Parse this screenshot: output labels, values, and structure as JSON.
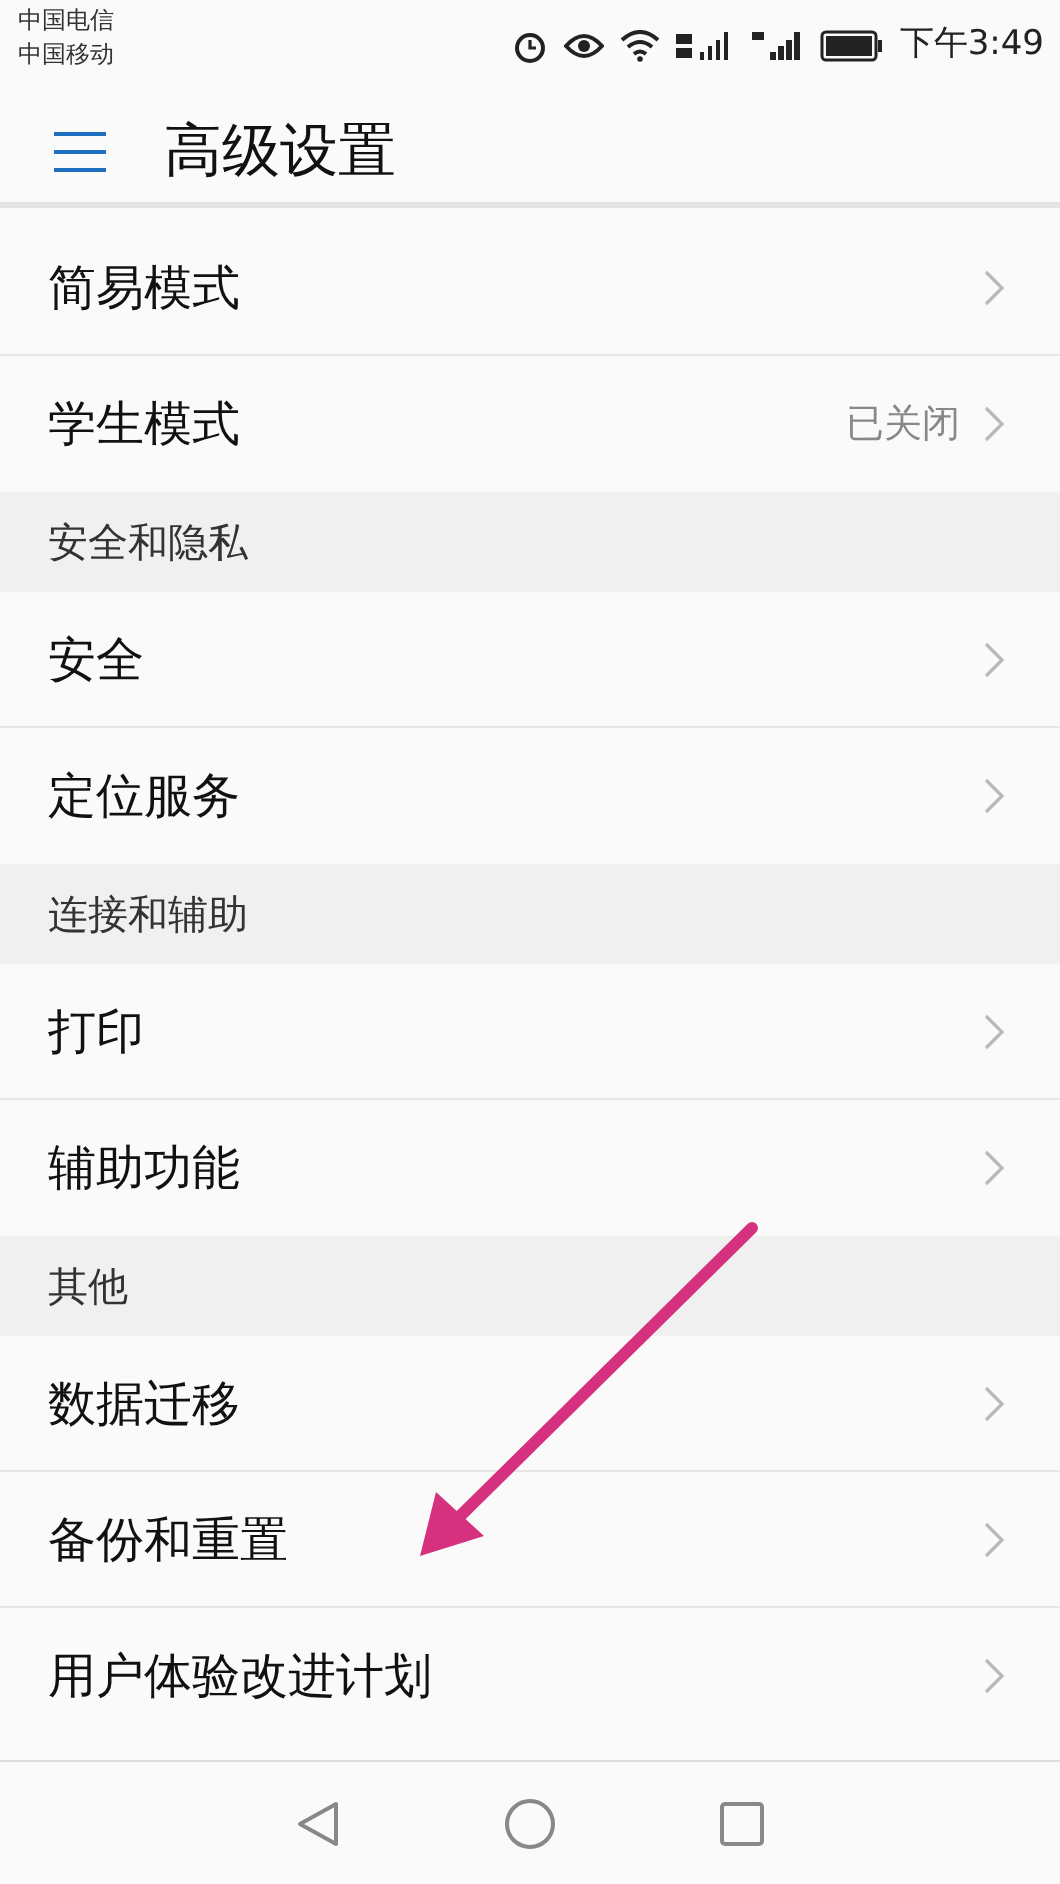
{
  "status_bar": {
    "carriers": [
      "中国电信",
      "中国移动"
    ],
    "time": "下午3:49"
  },
  "header": {
    "title": "高级设置"
  },
  "sections": [
    {
      "items": [
        {
          "label": "简易模式"
        },
        {
          "label": "学生模式",
          "value": "已关闭"
        }
      ]
    },
    {
      "title": "安全和隐私",
      "items": [
        {
          "label": "安全"
        },
        {
          "label": "定位服务"
        }
      ]
    },
    {
      "title": "连接和辅助",
      "items": [
        {
          "label": "打印"
        },
        {
          "label": "辅助功能"
        }
      ]
    },
    {
      "title": "其他",
      "items": [
        {
          "label": "数据迁移"
        },
        {
          "label": "备份和重置"
        },
        {
          "label": "用户体验改进计划"
        }
      ]
    }
  ]
}
